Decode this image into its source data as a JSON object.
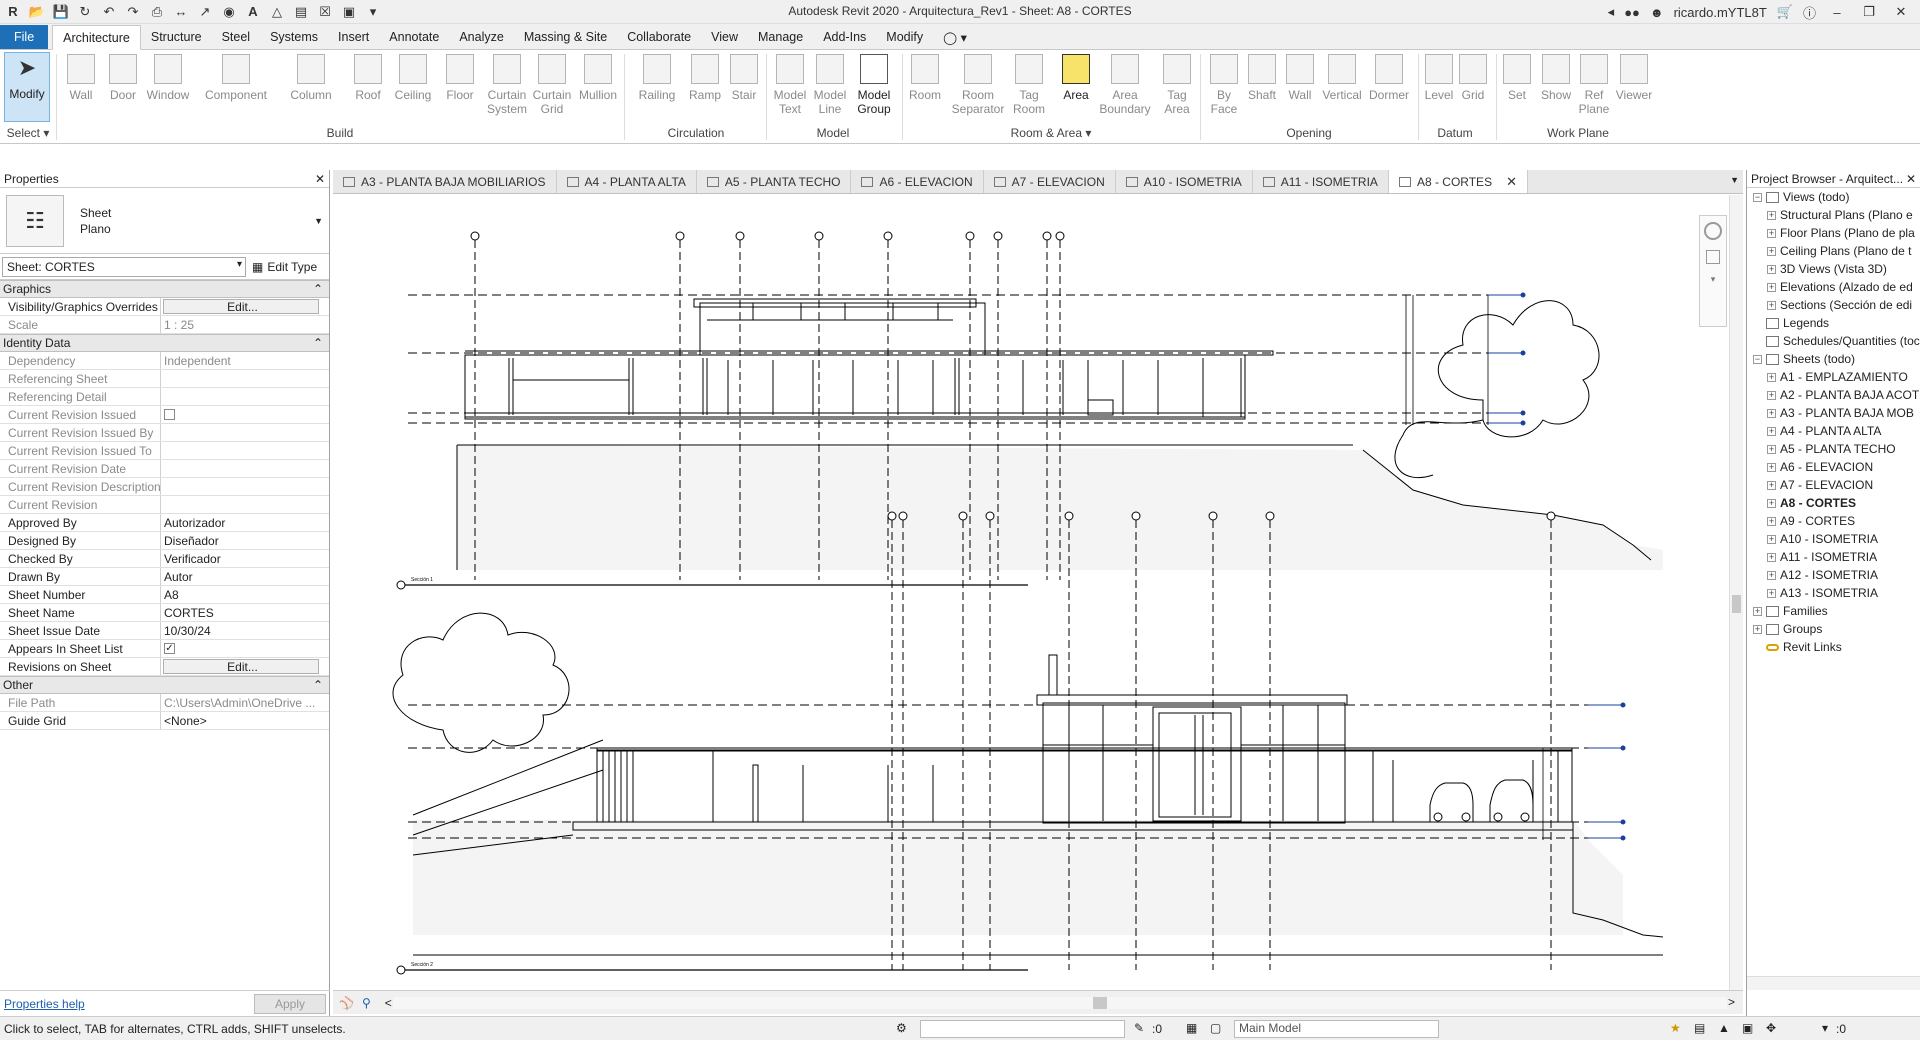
{
  "window": {
    "title": "Autodesk Revit 2020 - Arquitectura_Rev1 - Sheet: A8 - CORTES",
    "user": "ricardo.mYTL8T"
  },
  "ribbon_tabs": [
    "File",
    "Architecture",
    "Structure",
    "Steel",
    "Systems",
    "Insert",
    "Annotate",
    "Analyze",
    "Massing & Site",
    "Collaborate",
    "View",
    "Manage",
    "Add-Ins",
    "Modify"
  ],
  "active_tab": "Architecture",
  "ribbon": {
    "modify": "Modify",
    "select": "Select",
    "build_tools": [
      "Wall",
      "Door",
      "Window",
      "Component",
      "Column",
      "Roof",
      "Ceiling",
      "Floor",
      "Curtain System",
      "Curtain Grid",
      "Mullion"
    ],
    "circulation_tools": [
      "Railing",
      "Ramp",
      "Stair"
    ],
    "model_tools": [
      "Model Text",
      "Model Line",
      "Model Group"
    ],
    "room_tools": [
      "Room",
      "Room Separator",
      "Tag Room",
      "Area",
      "Area Boundary",
      "Tag Area"
    ],
    "opening_tools": [
      "By Face",
      "Shaft",
      "Wall",
      "Vertical",
      "Dormer"
    ],
    "datum_tools": [
      "Level",
      "Grid"
    ],
    "workplane_tools": [
      "Set",
      "Show",
      "Ref Plane",
      "Viewer"
    ],
    "panels": {
      "build": "Build",
      "circulation": "Circulation",
      "model": "Model",
      "room_area": "Room & Area",
      "opening": "Opening",
      "datum": "Datum",
      "work_plane": "Work Plane"
    }
  },
  "properties": {
    "title": "Properties",
    "type_name": "Sheet",
    "type_sub": "Plano",
    "instance_selector": "Sheet: CORTES",
    "edit_type": "Edit Type",
    "sections": {
      "graphics": "Graphics",
      "identity": "Identity Data",
      "other": "Other"
    },
    "graphics_rows": [
      {
        "k": "Visibility/Graphics Overrides",
        "v": "Edit..."
      },
      {
        "k": "Scale",
        "v": "1 : 25"
      }
    ],
    "identity_rows": [
      {
        "k": "Dependency",
        "v": "Independent"
      },
      {
        "k": "Referencing Sheet",
        "v": ""
      },
      {
        "k": "Referencing Detail",
        "v": ""
      },
      {
        "k": "Current Revision Issued",
        "v": ""
      },
      {
        "k": "Current Revision Issued By",
        "v": ""
      },
      {
        "k": "Current Revision Issued To",
        "v": ""
      },
      {
        "k": "Current Revision Date",
        "v": ""
      },
      {
        "k": "Current Revision Description",
        "v": ""
      },
      {
        "k": "Current Revision",
        "v": ""
      },
      {
        "k": "Approved By",
        "v": "Autorizador"
      },
      {
        "k": "Designed By",
        "v": "Diseñador"
      },
      {
        "k": "Checked By",
        "v": "Verificador"
      },
      {
        "k": "Drawn By",
        "v": "Autor"
      },
      {
        "k": "Sheet Number",
        "v": "A8"
      },
      {
        "k": "Sheet Name",
        "v": "CORTES"
      },
      {
        "k": "Sheet Issue Date",
        "v": "10/30/24"
      },
      {
        "k": "Appears In Sheet List",
        "v": ""
      },
      {
        "k": "Revisions on Sheet",
        "v": "Edit..."
      }
    ],
    "other_rows": [
      {
        "k": "File Path",
        "v": "C:\\Users\\Admin\\OneDrive ..."
      },
      {
        "k": "Guide Grid",
        "v": "<None>"
      }
    ],
    "help": "Properties help",
    "apply": "Apply"
  },
  "view_tabs": [
    "A3 - PLANTA BAJA MOBILIARIOS",
    "A4 - PLANTA ALTA",
    "A5 - PLANTA TECHO",
    "A6 - ELEVACION",
    "A7 - ELEVACION",
    "A10 - ISOMETRIA",
    "A11 - ISOMETRIA",
    "A8 - CORTES"
  ],
  "active_view": "A8 - CORTES",
  "drawing": {
    "section1_label": "Sección 1",
    "section2_label": "Sección 2"
  },
  "browser": {
    "title": "Project Browser - Arquitect...",
    "nodes": [
      {
        "label": "Views (todo)",
        "level": 0,
        "exp": "-"
      },
      {
        "label": "Structural Plans (Plano e",
        "level": 1,
        "exp": "+"
      },
      {
        "label": "Floor Plans (Plano de pla",
        "level": 1,
        "exp": "+"
      },
      {
        "label": "Ceiling Plans (Plano de t",
        "level": 1,
        "exp": "+"
      },
      {
        "label": "3D Views (Vista 3D)",
        "level": 1,
        "exp": "+"
      },
      {
        "label": "Elevations (Alzado de ed",
        "level": 1,
        "exp": "+"
      },
      {
        "label": "Sections (Sección de edi",
        "level": 1,
        "exp": "+"
      },
      {
        "label": "Legends",
        "level": 0,
        "exp": ""
      },
      {
        "label": "Schedules/Quantities (toc",
        "level": 0,
        "exp": ""
      },
      {
        "label": "Sheets (todo)",
        "level": 0,
        "exp": "-"
      },
      {
        "label": "A1 - EMPLAZAMIENTO",
        "level": 1,
        "exp": "+"
      },
      {
        "label": "A2 - PLANTA BAJA ACOT",
        "level": 1,
        "exp": "+"
      },
      {
        "label": "A3 - PLANTA BAJA MOB",
        "level": 1,
        "exp": "+"
      },
      {
        "label": "A4 - PLANTA ALTA",
        "level": 1,
        "exp": "+"
      },
      {
        "label": "A5 - PLANTA TECHO",
        "level": 1,
        "exp": "+"
      },
      {
        "label": "A6 - ELEVACION",
        "level": 1,
        "exp": "+"
      },
      {
        "label": "A7 - ELEVACION",
        "level": 1,
        "exp": "+"
      },
      {
        "label": "A8 - CORTES",
        "level": 1,
        "exp": "+",
        "bold": true
      },
      {
        "label": "A9 - CORTES",
        "level": 1,
        "exp": "+"
      },
      {
        "label": "A10 - ISOMETRIA",
        "level": 1,
        "exp": "+"
      },
      {
        "label": "A11 - ISOMETRIA",
        "level": 1,
        "exp": "+"
      },
      {
        "label": "A12 - ISOMETRIA",
        "level": 1,
        "exp": "+"
      },
      {
        "label": "A13 - ISOMETRIA",
        "level": 1,
        "exp": "+"
      },
      {
        "label": "Families",
        "level": 0,
        "exp": "+"
      },
      {
        "label": "Groups",
        "level": 0,
        "exp": "+"
      },
      {
        "label": "Revit Links",
        "level": 0,
        "exp": ""
      }
    ]
  },
  "status": {
    "message": "Click to select, TAB for alternates, CTRL adds, SHIFT unselects.",
    "workset_count": ":0",
    "design_option": "Main Model",
    "filter_count": ":0"
  }
}
